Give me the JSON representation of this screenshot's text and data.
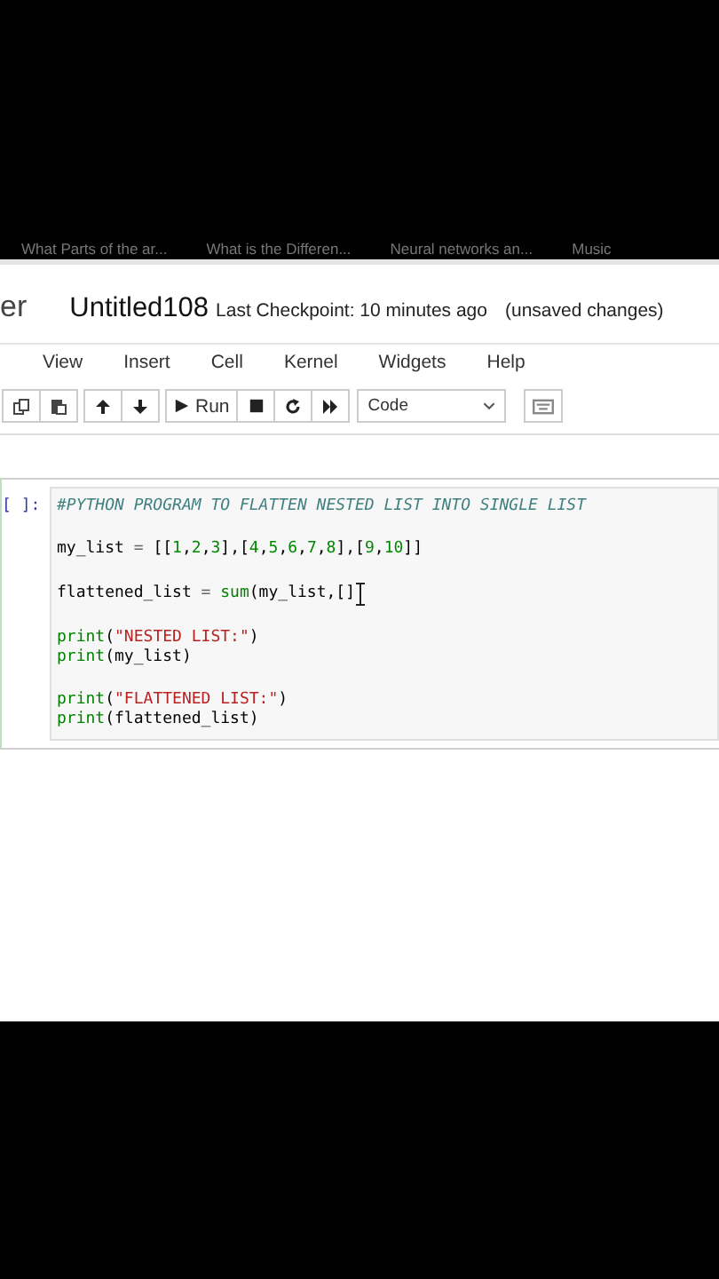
{
  "bookmarks": [
    {
      "label": "What Parts of the ar..."
    },
    {
      "label": "What is the Differen..."
    },
    {
      "label": "Neural networks an..."
    },
    {
      "label": "Music"
    }
  ],
  "header": {
    "logo_text": "er",
    "title": "Untitled108",
    "checkpoint": "Last Checkpoint: 10 minutes ago",
    "status": "(unsaved changes)"
  },
  "menu": [
    "View",
    "Insert",
    "Cell",
    "Kernel",
    "Widgets",
    "Help"
  ],
  "toolbar": {
    "run_label": "Run",
    "cell_type": "Code"
  },
  "cell": {
    "prompt": "[ ]:",
    "blocks": [
      {
        "lines": [
          {
            "tokens": [
              {
                "t": "#PYTHON PROGRAM TO FLATTEN NESTED LIST INTO SINGLE LIST",
                "kind": "comment"
              }
            ]
          }
        ]
      },
      {
        "lines": [
          {
            "tokens": [
              {
                "t": "my_list ",
                "kind": "name"
              },
              {
                "t": "=",
                "kind": "op"
              },
              {
                "t": " [[",
                "kind": "name"
              },
              {
                "t": "1",
                "kind": "number"
              },
              {
                "t": ",",
                "kind": "name"
              },
              {
                "t": "2",
                "kind": "number"
              },
              {
                "t": ",",
                "kind": "name"
              },
              {
                "t": "3",
                "kind": "number"
              },
              {
                "t": "],[",
                "kind": "name"
              },
              {
                "t": "4",
                "kind": "number"
              },
              {
                "t": ",",
                "kind": "name"
              },
              {
                "t": "5",
                "kind": "number"
              },
              {
                "t": ",",
                "kind": "name"
              },
              {
                "t": "6",
                "kind": "number"
              },
              {
                "t": ",",
                "kind": "name"
              },
              {
                "t": "7",
                "kind": "number"
              },
              {
                "t": ",",
                "kind": "name"
              },
              {
                "t": "8",
                "kind": "number"
              },
              {
                "t": "],[",
                "kind": "name"
              },
              {
                "t": "9",
                "kind": "number"
              },
              {
                "t": ",",
                "kind": "name"
              },
              {
                "t": "10",
                "kind": "number"
              },
              {
                "t": "]]",
                "kind": "name"
              }
            ]
          }
        ]
      },
      {
        "lines": [
          {
            "cursor": true,
            "tokens": [
              {
                "t": "flattened_list ",
                "kind": "name"
              },
              {
                "t": "= ",
                "kind": "op"
              },
              {
                "t": "sum",
                "kind": "builtin"
              },
              {
                "t": "(my_list,[]",
                "kind": "name"
              }
            ]
          }
        ]
      },
      {
        "lines": [
          {
            "tokens": [
              {
                "t": "print",
                "kind": "builtin"
              },
              {
                "t": "(",
                "kind": "name"
              },
              {
                "t": "\"NESTED LIST:\"",
                "kind": "string"
              },
              {
                "t": ")",
                "kind": "name"
              }
            ]
          },
          {
            "tokens": [
              {
                "t": "print",
                "kind": "builtin"
              },
              {
                "t": "(my_list)",
                "kind": "name"
              }
            ]
          }
        ]
      },
      {
        "lines": [
          {
            "tokens": [
              {
                "t": "print",
                "kind": "builtin"
              },
              {
                "t": "(",
                "kind": "name"
              },
              {
                "t": "\"FLATTENED LIST:\"",
                "kind": "string"
              },
              {
                "t": ")",
                "kind": "name"
              }
            ]
          },
          {
            "tokens": [
              {
                "t": "print",
                "kind": "builtin"
              },
              {
                "t": "(flattened_list)",
                "kind": "name"
              }
            ]
          }
        ]
      }
    ]
  }
}
